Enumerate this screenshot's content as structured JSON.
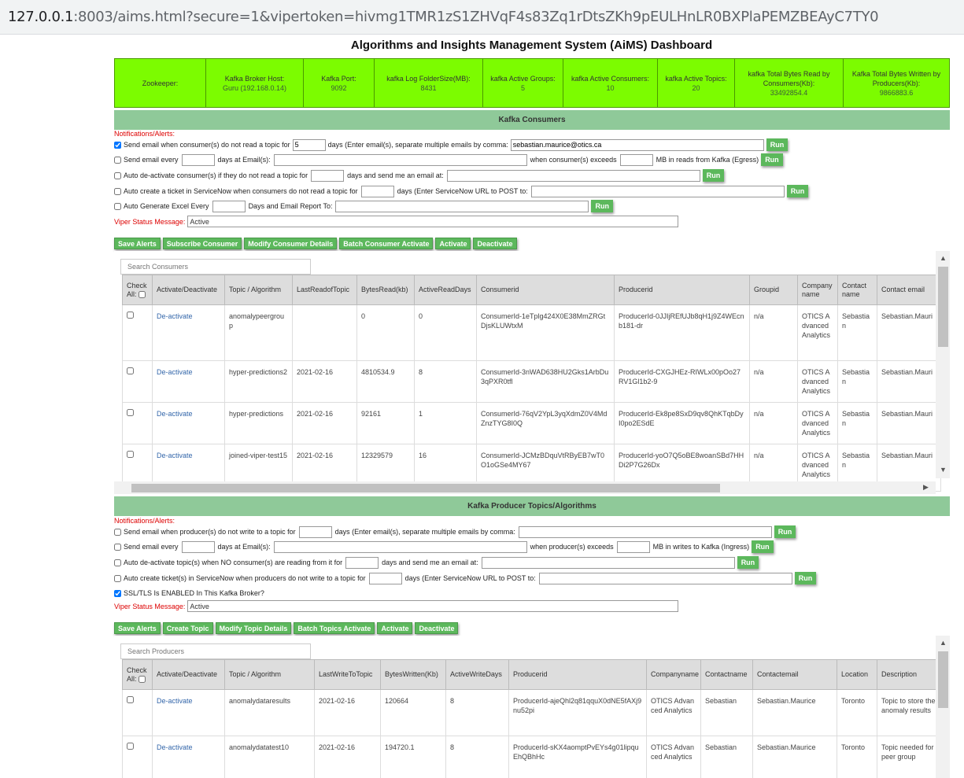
{
  "browser": {
    "url_host": "127.0.0.1",
    "url_rest": ":8003/aims.html?secure=1&vipertoken=hivmg1TMR1zS1ZHVqF4s83Zq1rDtsZKh9pEULHnLR0BXPlaPEMZBEAyC7TY0"
  },
  "page_title": "Algorithms and Insights Management System (AiMS) Dashboard",
  "stats": [
    {
      "label": "Zookeeper:",
      "value": ""
    },
    {
      "label": "Kafka Broker Host:",
      "value": "Guru (192.168.0.14)"
    },
    {
      "label": "Kafka Port:",
      "value": "9092"
    },
    {
      "label": "kafka Log FolderSize(MB):",
      "value": "8431"
    },
    {
      "label": "kafka Active Groups:",
      "value": "5"
    },
    {
      "label": "kafka Active Consumers:",
      "value": "10"
    },
    {
      "label": "kafka Active Topics:",
      "value": "20"
    },
    {
      "label": "kafka Total Bytes Read by Consumers(Kb):",
      "value": "33492854.4"
    },
    {
      "label": "Kafka Total Bytes Written by Producers(Kb):",
      "value": "9866883.6"
    }
  ],
  "consumers": {
    "section_title": "Kafka Consumers",
    "notif_label": "Notifications/Alerts:",
    "r1": {
      "a": "Send email when consumer(s) do not read a topic for",
      "days": "5",
      "b": "days (Enter email(s), separate multiple emails by comma:",
      "email": "sebastian.maurice@otics.ca",
      "run": "Run"
    },
    "r2": {
      "a": "Send email every",
      "b": "days at Email(s):",
      "c": "when consumer(s) exceeds",
      "d": "MB in reads from Kafka (Egress)",
      "run": "Run"
    },
    "r3": {
      "a": "Auto de-activate consumer(s) if they do not read a topic for",
      "b": "days and send me an email at:",
      "run": "Run"
    },
    "r4": {
      "a": "Auto create a ticket in ServiceNow when consumers do not read a topic for",
      "b": "days (Enter ServiceNow URL to POST to:",
      "run": "Run"
    },
    "r5": {
      "a": "Auto Generate Excel Every",
      "b": "Days and Email Report To:",
      "run": "Run"
    },
    "viper_label": "Viper Status Message:",
    "viper_value": "Active",
    "buttons": [
      "Save Alerts",
      "Subscribe Consumer",
      "Modify Consumer Details",
      "Batch Consumer Activate",
      "Activate",
      "Deactivate"
    ],
    "search_placeholder": "Search Consumers",
    "headers": [
      "Check All:",
      "Activate/Deactivate",
      "Topic / Algorithm",
      "LastReadofTopic",
      "BytesRead(kb)",
      "ActiveReadDays",
      "Consumerid",
      "Producerid",
      "Groupid",
      "Company name",
      "Contact name",
      "Contact email"
    ],
    "rows": [
      [
        "De-activate",
        "anomalypeergroup",
        "",
        "0",
        "0",
        "ConsumerId-1eTplg424X0E38MmZRGtDjsKLUWtxM",
        "ProducerId-0JJIjREfUJb8qH1j9Z4WEcnb181-dr",
        "n/a",
        "OTICS Advanced Analytics",
        "Sebastian",
        "Sebastian.Mauri"
      ],
      [
        "De-activate",
        "hyper-predictions2",
        "2021-02-16",
        "4810534.9",
        "8",
        "ConsumerId-3nWAD638HU2Gks1ArbDu3qPXR0tfl",
        "ProducerId-CXGJHEz-RIWLx00pOo27RV1Gl1b2-9",
        "n/a",
        "OTICS Advanced Analytics",
        "Sebastian",
        "Sebastian.Mauri"
      ],
      [
        "De-activate",
        "hyper-predictions",
        "2021-02-16",
        "92161",
        "1",
        "ConsumerId-76qV2YpL3yqXdmZ0V4MdZnzTYG8I0Q",
        "ProducerId-Ek8pe8SxD9qv8QhKTqbDyI0po2ESdE",
        "n/a",
        "OTICS Advanced Analytics",
        "Sebastian",
        "Sebastian.Mauri"
      ],
      [
        "De-activate",
        "joined-viper-test15",
        "2021-02-16",
        "12329579",
        "16",
        "ConsumerId-JCMzBDquVtRByEB7wT0O1oGSe4MY67",
        "ProducerId-yoO7Q5oBE8woanSBd7HHDi2P7G26Dx",
        "n/a",
        "OTICS Advanced Analytics",
        "Sebastian",
        "Sebastian.Mauri"
      ]
    ]
  },
  "producers": {
    "section_title": "Kafka Producer Topics/Algorithms",
    "notif_label": "Notifications/Alerts:",
    "r1": {
      "a": "Send email when producer(s) do not write to a topic for",
      "b": "days (Enter email(s), separate multiple emails by comma:",
      "run": "Run"
    },
    "r2": {
      "a": "Send email every",
      "b": "days at Email(s):",
      "c": "when producer(s) exceeds",
      "d": "MB in writes to Kafka (Ingress)",
      "run": "Run"
    },
    "r3": {
      "a": "Auto de-activate topic(s) when NO consumer(s) are reading from it for",
      "b": "days and send me an email at:",
      "run": "Run"
    },
    "r4": {
      "a": "Auto create ticket(s) in ServiceNow when producers do not write to a topic for",
      "b": "days (Enter ServiceNow URL to POST to:",
      "run": "Run"
    },
    "ssl_label": "SSL/TLS Is ENABLED In This Kafka Broker?",
    "viper_label": "Viper Status Message:",
    "viper_value": "Active",
    "buttons": [
      "Save Alerts",
      "Create Topic",
      "Modify Topic Details",
      "Batch Topics Activate",
      "Activate",
      "Deactivate"
    ],
    "search_placeholder": "Search Producers",
    "headers": [
      "Check All:",
      "Activate/Deactivate",
      "Topic / Algorithm",
      "LastWriteToTopic",
      "BytesWritten(Kb)",
      "ActiveWriteDays",
      "Producerid",
      "Companyname",
      "Contactname",
      "Contactemail",
      "Location",
      "Description"
    ],
    "rows": [
      [
        "De-activate",
        "anomalydataresults",
        "2021-02-16",
        "120664",
        "8",
        "ProducerId-ajeQhl2q81qquX0dNE5fAXj9nu52pi",
        "OTICS Advanced Analytics",
        "Sebastian",
        "Sebastian.Maurice",
        "Toronto",
        "Topic to store the anomaly results"
      ],
      [
        "De-activate",
        "anomalydatatest10",
        "2021-02-16",
        "194720.1",
        "8",
        "ProducerId-sKX4aomptPvEYs4g01lipquEhQBhHc",
        "OTICS Advanced Analytics",
        "Sebastian",
        "Sebastian.Maurice",
        "Toronto",
        "Topic needed for peer group"
      ]
    ]
  }
}
